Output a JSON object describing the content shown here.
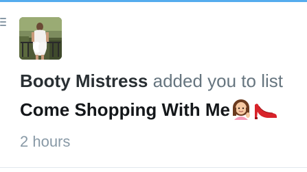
{
  "notification": {
    "icon": "list-icon",
    "actor_name": "Booty Mistress",
    "action_text": "added you to list",
    "list_name": "Come Shopping With Me",
    "list_emojis": [
      "woman-tipping-hand-emoji",
      "high-heel-shoe-emoji"
    ],
    "timestamp": "2 hours"
  },
  "colors": {
    "accent": "#55acee",
    "primary_text": "#292f33",
    "secondary_text": "#66757f",
    "timestamp_text": "#8899a6"
  }
}
